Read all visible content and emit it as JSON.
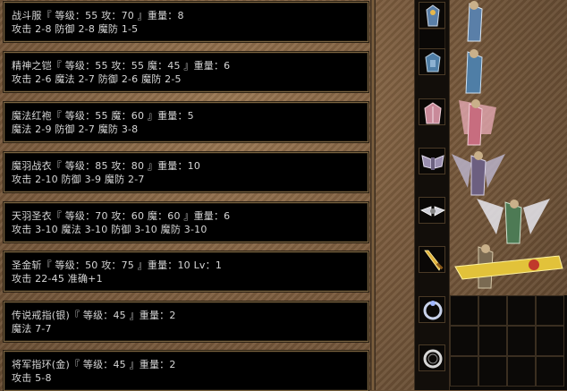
{
  "items": [
    {
      "name_line": "战斗服『 等级：55 攻：70 』重量：8",
      "stat_line": "攻击 2-8 防御 2-8 魔防 1-5"
    },
    {
      "name_line": "精神之铠『 等级：55 攻：55 魔：45 』重量：6",
      "stat_line": "攻击 2-6 魔法 2-7 防御 2-6 魔防 2-5"
    },
    {
      "name_line": "魔法红袍『 等级：55 魔：60 』重量：5",
      "stat_line": "魔法 2-9 防御 2-7 魔防 3-8"
    },
    {
      "name_line": "魔羽战衣『 等级：85 攻：80 』重量：10",
      "stat_line": "攻击 2-10 防御 3-9 魔防 2-7"
    },
    {
      "name_line": "天羽圣衣『 等级：70 攻：60 魔：60 』重量：6",
      "stat_line": "攻击 3-10 魔法 3-10 防御 3-10 魔防 3-10"
    },
    {
      "name_line": "圣金斩『 等级：50 攻：75 』重量：10 Lv：1",
      "stat_line": "攻击 22-45 准确+1"
    },
    {
      "name_line": "传说戒指(银)『 等级：45 』重量：2",
      "stat_line": "魔法 7-7"
    },
    {
      "name_line": "将军指环(金)『 等级：45 』重量：2",
      "stat_line": "攻击 5-8"
    }
  ],
  "slots": [
    {
      "icon": "armor-blue-icon"
    },
    {
      "icon": "empty"
    },
    {
      "icon": "armor-blue-icon"
    },
    {
      "icon": "robe-pink-icon"
    },
    {
      "icon": "wing-armor-icon"
    },
    {
      "icon": "wing-robe-icon"
    },
    {
      "icon": "golden-sword-icon"
    },
    {
      "icon": "empty"
    },
    {
      "icon": "silver-ring-icon"
    },
    {
      "icon": "gold-ring-icon"
    }
  ]
}
